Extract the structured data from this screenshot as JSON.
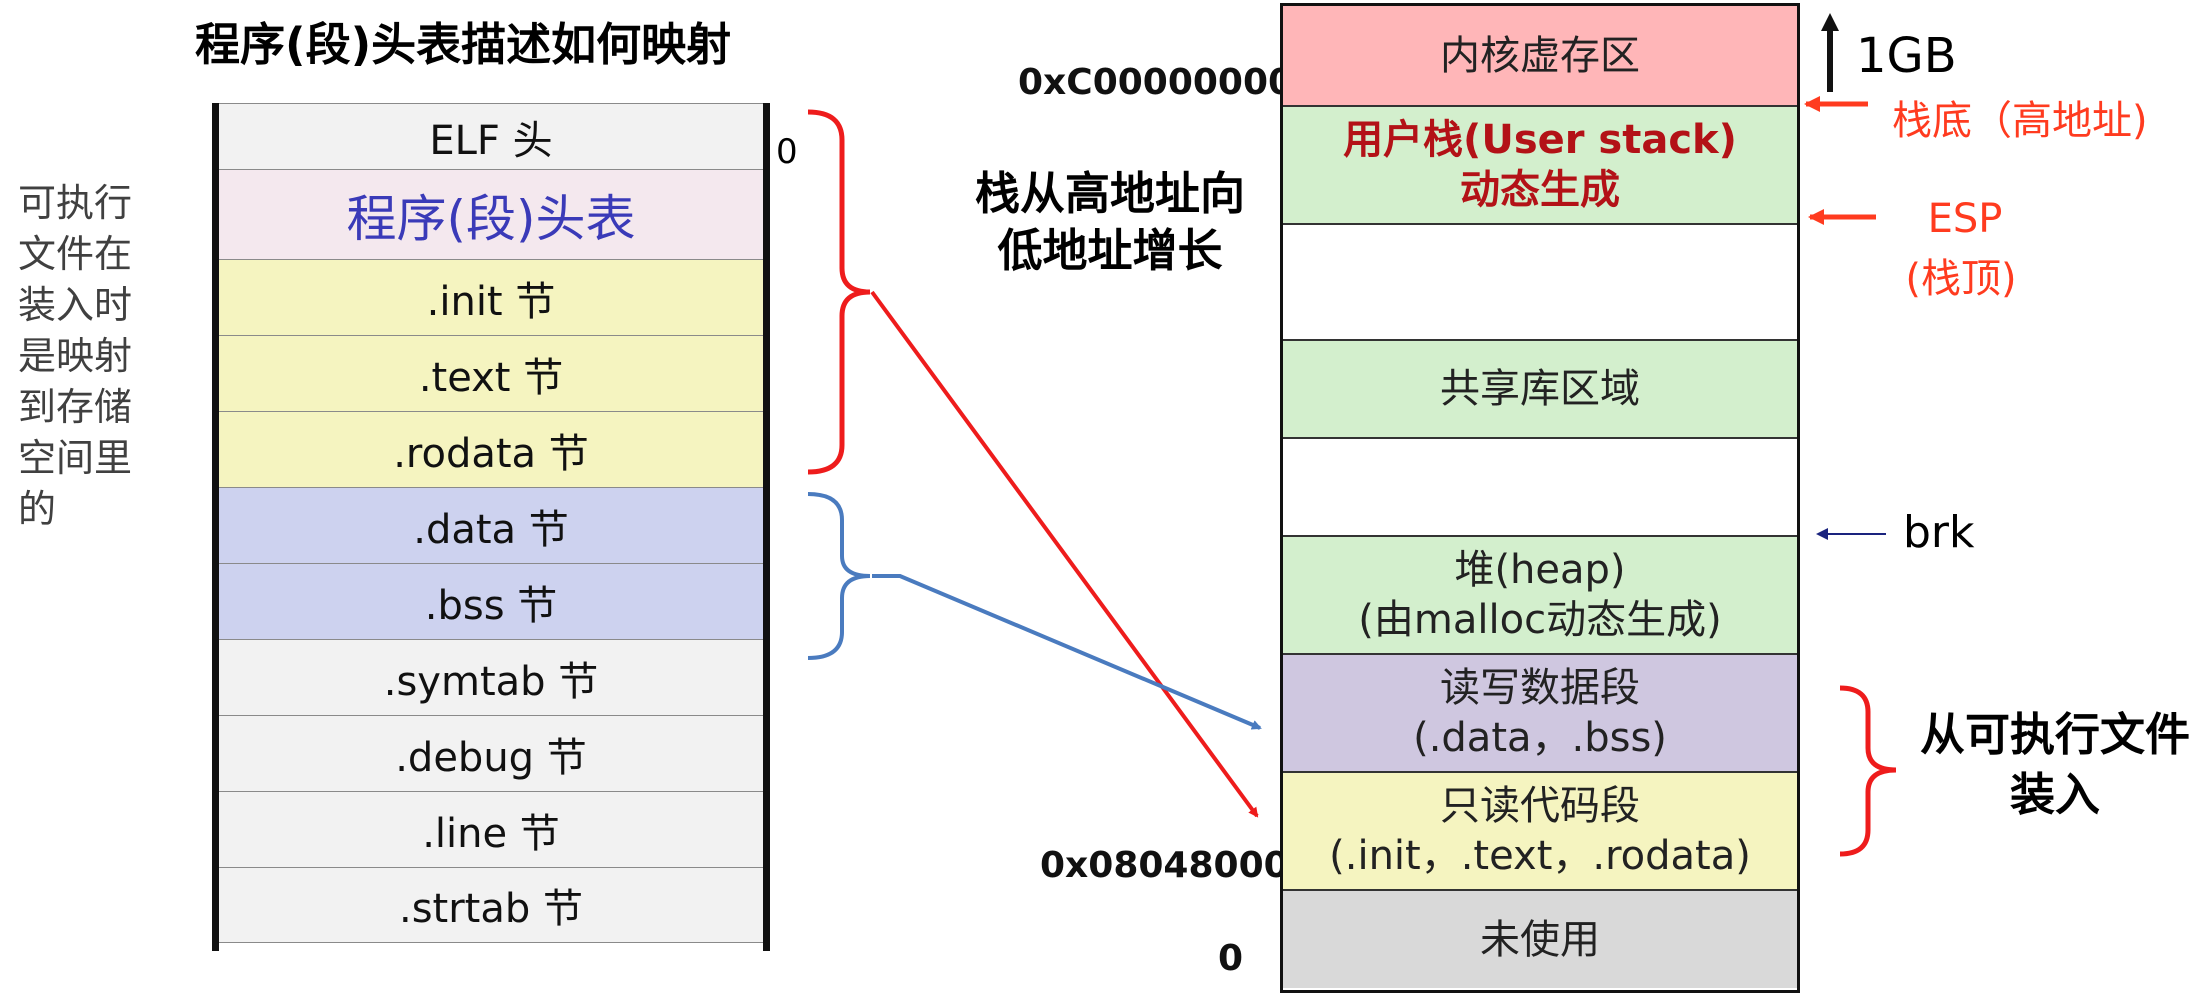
{
  "title": "程序(段)头表描述如何映射",
  "side_note": "可执行文件在装入时是映射到存储空间里的",
  "elf_offset_zero": "0",
  "elf_sections": [
    {
      "label": "ELF 头",
      "kind": "hdr"
    },
    {
      "label": "程序(段)头表",
      "kind": "ph"
    },
    {
      "label": ".init 节",
      "kind": "ro"
    },
    {
      "label": ".text 节",
      "kind": "ro"
    },
    {
      "label": ".rodata 节",
      "kind": "ro"
    },
    {
      "label": ".data 节",
      "kind": "rw"
    },
    {
      "label": ".bss 节",
      "kind": "rw"
    },
    {
      "label": ".symtab 节",
      "kind": "oth"
    },
    {
      "label": ".debug 节",
      "kind": "oth"
    },
    {
      "label": ".line 节",
      "kind": "oth"
    },
    {
      "label": ".strtab 节",
      "kind": "oth"
    }
  ],
  "memory_regions": [
    {
      "lines": [
        "内核虚存区"
      ],
      "kind": "kern"
    },
    {
      "lines": [
        "用户栈(User stack)",
        "动态生成"
      ],
      "kind": "stack"
    },
    {
      "lines": [],
      "kind": "gap"
    },
    {
      "lines": [
        "共享库区域"
      ],
      "kind": "green"
    },
    {
      "lines": [],
      "kind": "gap"
    },
    {
      "lines": [
        "堆(heap)",
        "(由malloc动态生成)"
      ],
      "kind": "green"
    },
    {
      "lines": [
        "读写数据段",
        "(.data，.bss)"
      ],
      "kind": "rw"
    },
    {
      "lines": [
        "只读代码段",
        "(.init，.text，.rodata)"
      ],
      "kind": "ro"
    },
    {
      "lines": [
        "未使用"
      ],
      "kind": "unused"
    }
  ],
  "addresses": {
    "kernel_base": "0xC00000000",
    "text_base": "0x08048000",
    "bottom": "0"
  },
  "labels": {
    "stack_growth": "栈从高地址向低地址增长",
    "one_gb": "1GB",
    "stack_bottom": "栈底（高地址)",
    "esp": "ESP",
    "esp_note": "(栈顶)",
    "brk": "brk",
    "loaded_from_exe": "从可执行文件装入"
  },
  "colors": {
    "ro_brace_arrow": "#ee1c1c",
    "rw_brace_arrow": "#4a7bbf",
    "pointer_red": "#ff3b1f",
    "brk_arrow": "#1a237e"
  }
}
